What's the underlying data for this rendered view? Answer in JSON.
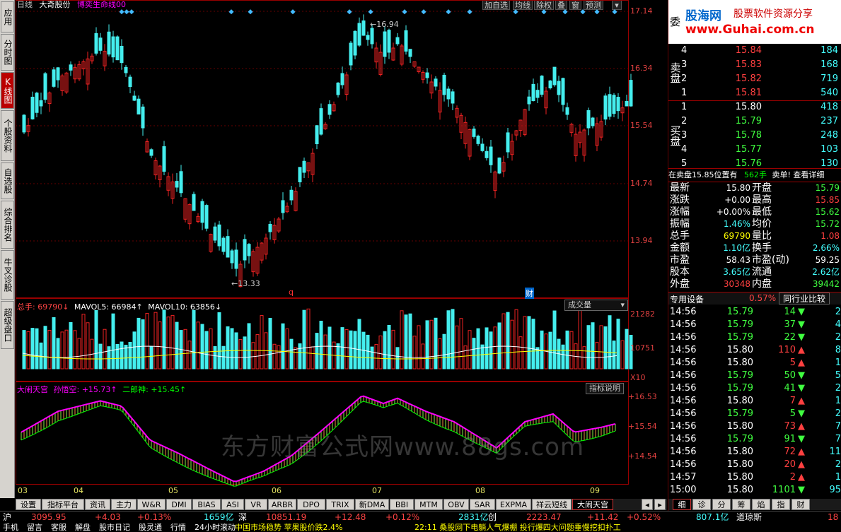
{
  "left_tabs": [
    "应用",
    "分时图",
    "K线图",
    "个股资料",
    "自选股",
    "综合排名",
    "牛叉诊股",
    "超级盘口"
  ],
  "chart_header": {
    "period": "日线",
    "stock": "大奇股份",
    "indicator": "博奕生命线00"
  },
  "toolbar": [
    "加自选",
    "均线",
    "除权",
    "叠",
    "窗",
    "预测"
  ],
  "price_axis": [
    "17.14",
    "16.34",
    "15.54",
    "14.74",
    "13.94"
  ],
  "annotations": {
    "high": "16.94",
    "low": "13.33",
    "q_marker": "q",
    "cai_marker": "财"
  },
  "volume": {
    "label_total": "总手: 69790↓",
    "label_ma5": "MAVOL5: 66984↑",
    "label_ma10": "MAVOL10: 63856↓",
    "axis": [
      "21282",
      "10751"
    ],
    "unit": "X10",
    "dropdown": "成交量"
  },
  "indicator_panel": {
    "name": "大闹天宫",
    "line1": "孙悟空: +15.73↑",
    "line2": "二郎神: +15.45↑",
    "axis": [
      "+16.53",
      "+15.54",
      "+14.54"
    ],
    "button": "指标说明"
  },
  "x_axis": [
    "03",
    "04",
    "05",
    "06",
    "07",
    "08",
    "09"
  ],
  "watermark": "东方财富公式网www.88gs.com",
  "bottom_tabs": [
    "设置",
    "指标平台",
    "资讯",
    "主力",
    "W&R",
    "DMI",
    "BIAS",
    "ASI",
    "VR",
    "ARBR",
    "DPO",
    "TRIX",
    "新DMA",
    "BBI",
    "MTM",
    "OBV",
    "SAR",
    "EXPMA",
    "祥云短线",
    "大闹天宫"
  ],
  "right_tabs": [
    "细",
    "诊",
    "分",
    "筹",
    "焰",
    "指",
    "财"
  ],
  "logo": {
    "brand": "股海网",
    "slogan": "股票软件资源分享",
    "url": "www.Guhai.com.cn",
    "side": "委"
  },
  "sell_side": "卖盘",
  "buy_side": "买盘",
  "sells": [
    {
      "n": "4",
      "p": "15.84",
      "v": "184"
    },
    {
      "n": "3",
      "p": "15.83",
      "v": "168"
    },
    {
      "n": "2",
      "p": "15.82",
      "v": "719"
    },
    {
      "n": "1",
      "p": "15.81",
      "v": "540"
    }
  ],
  "buys": [
    {
      "n": "1",
      "p": "15.80",
      "v": "418"
    },
    {
      "n": "2",
      "p": "15.79",
      "v": "237"
    },
    {
      "n": "3",
      "p": "15.78",
      "v": "248"
    },
    {
      "n": "4",
      "p": "15.77",
      "v": "103"
    },
    {
      "n": "5",
      "p": "15.76",
      "v": "130"
    }
  ],
  "notice": {
    "text1": "在卖盘15.85位置有",
    "qty": "562手",
    "text2": "卖单! 查看详细"
  },
  "quote": [
    {
      "l": "最新",
      "v": "15.80",
      "vc": "white",
      "l2": "开盘",
      "v2": "15.79",
      "v2c": "green"
    },
    {
      "l": "涨跌",
      "v": "+0.00",
      "vc": "white",
      "l2": "最高",
      "v2": "15.85",
      "v2c": "red"
    },
    {
      "l": "涨幅",
      "v": "+0.00%",
      "vc": "white",
      "l2": "最低",
      "v2": "15.62",
      "v2c": "green"
    },
    {
      "l": "振幅",
      "v": "1.46%",
      "vc": "cyan",
      "l2": "均价",
      "v2": "15.72",
      "v2c": "green"
    },
    {
      "l": "总手",
      "v": "69790",
      "vc": "yellow",
      "l2": "量比",
      "v2": "1.08",
      "v2c": "red"
    },
    {
      "l": "金额",
      "v": "1.10亿",
      "vc": "cyan",
      "l2": "换手",
      "v2": "2.66%",
      "v2c": "cyan"
    },
    {
      "l": "市盈",
      "v": "58.43",
      "vc": "white",
      "l2": "市盈(动)",
      "v2": "59.25",
      "v2c": "white"
    },
    {
      "l": "股本",
      "v": "3.65亿",
      "vc": "cyan",
      "l2": "流通",
      "v2": "2.62亿",
      "v2c": "cyan"
    },
    {
      "l": "外盘",
      "v": "30348",
      "vc": "red",
      "l2": "内盘",
      "v2": "39442",
      "v2c": "green"
    }
  ],
  "special": {
    "label": "专用设备",
    "pct": "0.57%",
    "btn": "同行业比较"
  },
  "ticks": [
    {
      "t": "14:56",
      "p": "15.79",
      "pc": "green",
      "v": "14",
      "d": "down",
      "c": "2"
    },
    {
      "t": "14:56",
      "p": "15.79",
      "pc": "green",
      "v": "37",
      "d": "down",
      "c": "4"
    },
    {
      "t": "14:56",
      "p": "15.79",
      "pc": "green",
      "v": "22",
      "d": "down",
      "c": "2"
    },
    {
      "t": "14:56",
      "p": "15.80",
      "pc": "white",
      "v": "110",
      "d": "up",
      "c": "8"
    },
    {
      "t": "14:56",
      "p": "15.80",
      "pc": "white",
      "v": "5",
      "d": "up",
      "c": "1"
    },
    {
      "t": "14:56",
      "p": "15.79",
      "pc": "green",
      "v": "50",
      "d": "down",
      "c": "5"
    },
    {
      "t": "14:56",
      "p": "15.79",
      "pc": "green",
      "v": "41",
      "d": "down",
      "c": "2"
    },
    {
      "t": "14:56",
      "p": "15.80",
      "pc": "white",
      "v": "7",
      "d": "up",
      "c": "1"
    },
    {
      "t": "14:56",
      "p": "15.79",
      "pc": "green",
      "v": "5",
      "d": "down",
      "c": "2"
    },
    {
      "t": "14:56",
      "p": "15.80",
      "pc": "white",
      "v": "73",
      "d": "up",
      "c": "7"
    },
    {
      "t": "14:56",
      "p": "15.79",
      "pc": "green",
      "v": "91",
      "d": "down",
      "c": "7"
    },
    {
      "t": "14:56",
      "p": "15.80",
      "pc": "white",
      "v": "72",
      "d": "up",
      "c": "11"
    },
    {
      "t": "14:56",
      "p": "15.80",
      "pc": "white",
      "v": "20",
      "d": "up",
      "c": "2"
    },
    {
      "t": "14:57",
      "p": "15.80",
      "pc": "white",
      "v": "2",
      "d": "up",
      "c": "1"
    },
    {
      "t": "15:00",
      "p": "15.80",
      "pc": "white",
      "v": "1101",
      "d": "down",
      "c": "95"
    }
  ],
  "status": {
    "sh": "沪",
    "sh_idx": "3095.95",
    "sh_chg": "+4.03",
    "sh_pct": "+0.13%",
    "sh_amt": "1659亿",
    "sz": "深",
    "sz_idx": "10851.19",
    "sz_chg": "+12.48",
    "sz_pct": "+0.12%",
    "sz_amt": "2831亿",
    "cy": "创",
    "cy_idx": "2223.47",
    "cy_chg": "+11.42",
    "cy_pct": "+0.52%",
    "cy_amt": "807.1亿",
    "dj": "道琼斯",
    "dj_idx": "18",
    "menu": [
      "手机",
      "留言",
      "客服",
      "解盘",
      "股市日记",
      "股灵通",
      "行情",
      "24小时滚动"
    ],
    "news1": "中国市场稳势 苹果股价跌2.4%",
    "news2": "22:11 桑股网下电躺人气爆棚 投行爆四大问题垂慢挖扣扑工"
  }
}
